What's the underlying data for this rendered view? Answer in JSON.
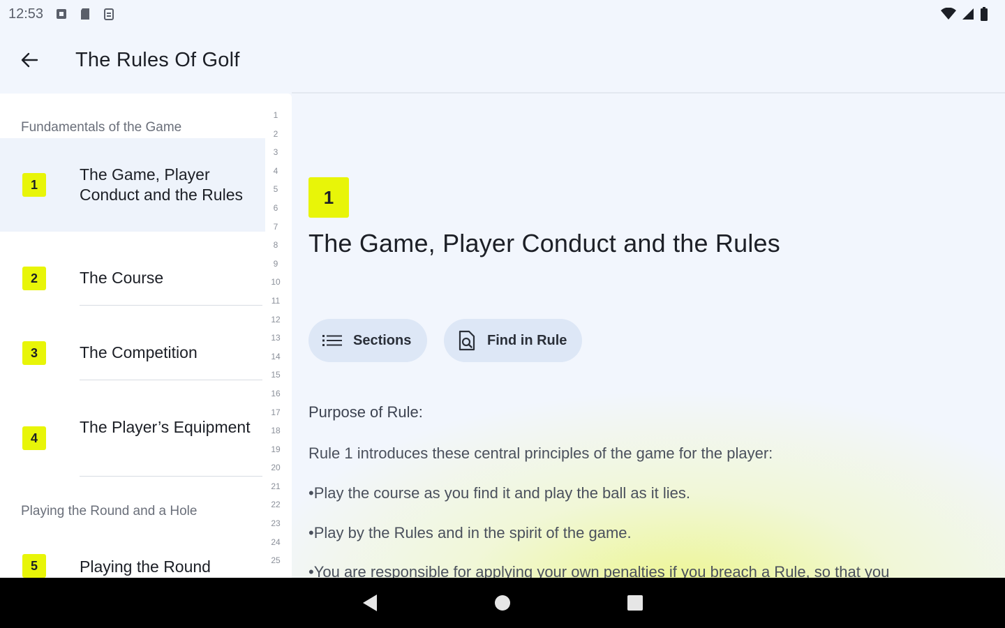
{
  "status": {
    "time": "12:53"
  },
  "app_bar": {
    "title": "The Rules Of Golf"
  },
  "sidebar": {
    "sections": [
      {
        "label": "Fundamentals of the Game"
      },
      {
        "label": "Playing the Round and a Hole"
      }
    ],
    "rules": [
      {
        "num": "1",
        "label": "The Game, Player Conduct and the Rules"
      },
      {
        "num": "2",
        "label": "The Course"
      },
      {
        "num": "3",
        "label": "The Competition"
      },
      {
        "num": "4",
        "label": "The Player’s Equipment"
      },
      {
        "num": "5",
        "label": "Playing the Round"
      }
    ],
    "line_numbers": [
      "1",
      "2",
      "3",
      "4",
      "5",
      "6",
      "7",
      "8",
      "9",
      "10",
      "11",
      "12",
      "13",
      "14",
      "15",
      "16",
      "17",
      "18",
      "19",
      "20",
      "21",
      "22",
      "23",
      "24",
      "25"
    ]
  },
  "main": {
    "rule_num": "1",
    "title": "The Game, Player Conduct and the Rules",
    "sections_label": "Sections",
    "find_label": "Find in Rule",
    "purpose_heading": "Purpose of Rule:",
    "paragraphs": [
      "Rule 1 introduces these central principles of the game for the player:",
      "•Play the course as you find it and play the ball as it lies.",
      "•Play by the Rules and in the spirit of the game.",
      "•You are responsible for applying your own penalties if you breach a Rule, so that you"
    ]
  },
  "colors": {
    "accent": "#e8f508",
    "chip_bg": "#dde7f6",
    "background": "#f2f6fd"
  }
}
